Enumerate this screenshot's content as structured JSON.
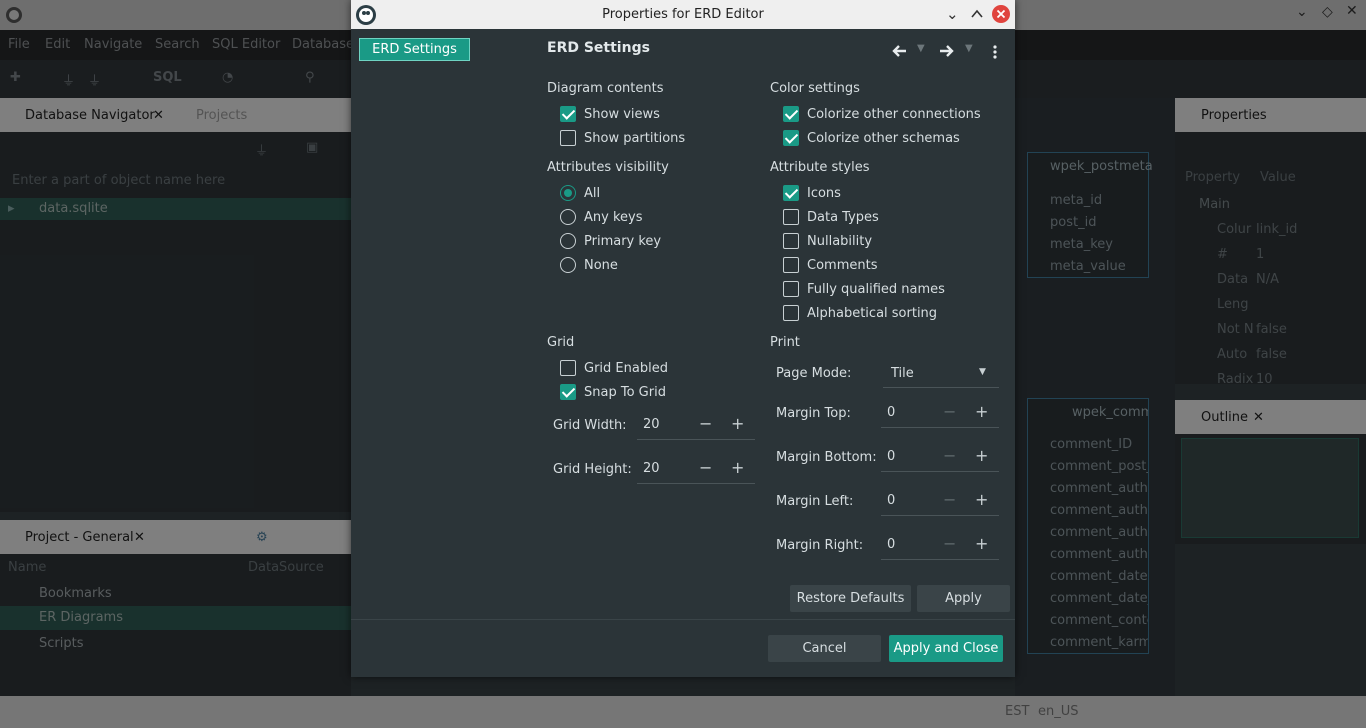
{
  "app": {
    "menu": [
      "File",
      "Edit",
      "Navigate",
      "Search",
      "SQL Editor",
      "Database"
    ],
    "toolbar_sql": "SQL",
    "navigator": {
      "title": "Database Navigator",
      "tab2": "Projects",
      "filter_placeholder": "Enter a part of object name here",
      "items": [
        "data.sqlite"
      ]
    },
    "project": {
      "title": "Project - General",
      "col_name": "Name",
      "col_ds": "DataSource",
      "items": [
        "Bookmarks",
        "ER Diagrams",
        "Scripts"
      ]
    },
    "properties": {
      "title": "Properties",
      "col_prop": "Property",
      "col_val": "Value",
      "group": "Main",
      "rows": [
        {
          "k": "Colur",
          "v": "link_id"
        },
        {
          "k": "#",
          "v": "1"
        },
        {
          "k": "Data",
          "v": "N/A"
        },
        {
          "k": "Leng",
          "v": ""
        },
        {
          "k": "Not N",
          "v": "false"
        },
        {
          "k": "Auto",
          "v": "false"
        },
        {
          "k": "Radix",
          "v": "10"
        }
      ]
    },
    "outline": {
      "title": "Outline"
    },
    "erd": {
      "table1": {
        "name": "wpek_postmeta",
        "cols": [
          "meta_id",
          "post_id",
          "meta_key",
          "meta_value"
        ]
      },
      "table2": {
        "name": "wpek_comm",
        "cols": [
          "comment_ID",
          "comment_post_",
          "comment_autho",
          "comment_autho",
          "comment_autho",
          "comment_autho",
          "comment_date",
          "comment_date_",
          "comment_conte",
          "comment_karm"
        ]
      }
    },
    "status": {
      "tz": "EST",
      "locale": "en_US"
    }
  },
  "dialog": {
    "title": "Properties for ERD Editor",
    "nav_selected": "ERD Settings",
    "heading": "ERD Settings",
    "diagram_contents": {
      "label": "Diagram contents",
      "items": [
        {
          "label": "Show views",
          "checked": true
        },
        {
          "label": "Show partitions",
          "checked": false
        }
      ]
    },
    "attr_visibility": {
      "label": "Attributes visibility",
      "options": [
        {
          "label": "All",
          "selected": true
        },
        {
          "label": "Any keys",
          "selected": false
        },
        {
          "label": "Primary key",
          "selected": false
        },
        {
          "label": "None",
          "selected": false
        }
      ]
    },
    "color_settings": {
      "label": "Color settings",
      "items": [
        {
          "label": "Colorize other connections",
          "checked": true
        },
        {
          "label": "Colorize other schemas",
          "checked": true
        }
      ]
    },
    "attr_styles": {
      "label": "Attribute styles",
      "items": [
        {
          "label": "Icons",
          "checked": true
        },
        {
          "label": "Data Types",
          "checked": false
        },
        {
          "label": "Nullability",
          "checked": false
        },
        {
          "label": "Comments",
          "checked": false
        },
        {
          "label": "Fully qualified names",
          "checked": false
        },
        {
          "label": "Alphabetical sorting",
          "checked": false
        }
      ]
    },
    "grid": {
      "label": "Grid",
      "items": [
        {
          "label": "Grid Enabled",
          "checked": false
        },
        {
          "label": "Snap To Grid",
          "checked": true
        }
      ],
      "width_label": "Grid Width:",
      "width": "20",
      "height_label": "Grid Height:",
      "height": "20"
    },
    "print": {
      "label": "Print",
      "page_mode_label": "Page Mode:",
      "page_mode": "Tile",
      "margin_top_label": "Margin Top:",
      "margin_top": "0",
      "margin_bottom_label": "Margin Bottom:",
      "margin_bottom": "0",
      "margin_left_label": "Margin Left:",
      "margin_left": "0",
      "margin_right_label": "Margin Right:",
      "margin_right": "0"
    },
    "buttons": {
      "restore": "Restore Defaults",
      "apply": "Apply",
      "cancel": "Cancel",
      "apply_close": "Apply and Close"
    },
    "colors": {
      "accent": "#1a9a86",
      "bg": "#2b3438",
      "close": "#e0443e"
    }
  }
}
